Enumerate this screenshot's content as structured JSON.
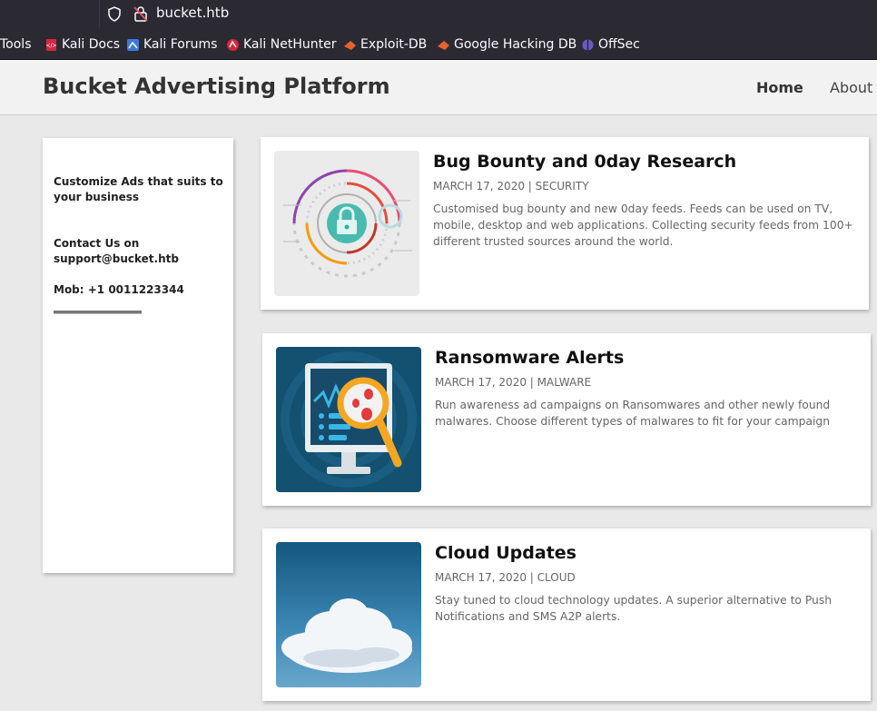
{
  "browser": {
    "url": "bucket.htb",
    "bookmarks": [
      {
        "label": "Tools"
      },
      {
        "label": "Kali Docs"
      },
      {
        "label": "Kali Forums"
      },
      {
        "label": "Kali NetHunter"
      },
      {
        "label": "Exploit-DB"
      },
      {
        "label": "Google Hacking DB"
      },
      {
        "label": "OffSec"
      }
    ]
  },
  "header": {
    "brand": "Bucket Advertising Platform",
    "nav": [
      {
        "label": "Home"
      },
      {
        "label": "About"
      }
    ]
  },
  "sidebar": {
    "line1": "Customize Ads that suits to your business",
    "line2": "Contact Us on support@bucket.htb",
    "line3": "Mob: +1 0011223344"
  },
  "posts": [
    {
      "title": "Bug Bounty and 0day Research",
      "meta": "MARCH 17, 2020 | SECURITY",
      "desc": "Customised bug bounty and new 0day feeds. Feeds can be used on TV, mobile, desktop and web applications. Collecting security feeds from 100+ different trusted sources around the world."
    },
    {
      "title": "Ransomware Alerts",
      "meta": "MARCH 17, 2020 | MALWARE",
      "desc": "Run awareness ad campaigns on Ransomwares and other newly found malwares. Choose different types of malwares to fit for your campaign"
    },
    {
      "title": "Cloud Updates",
      "meta": "MARCH 17, 2020 | CLOUD",
      "desc": "Stay tuned to cloud technology updates. A superior alternative to Push Notifications and SMS A2P alerts."
    }
  ]
}
